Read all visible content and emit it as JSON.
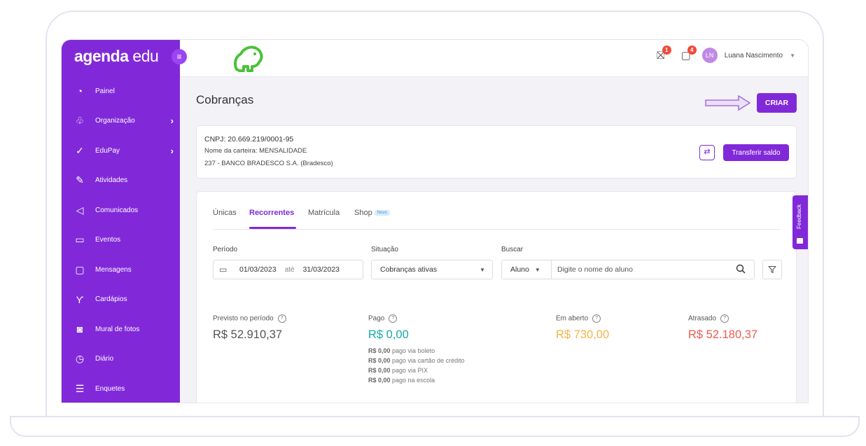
{
  "brand": {
    "name_bold": "agenda",
    "name_light": "edu"
  },
  "sidebar": {
    "items": [
      {
        "label": "Painel",
        "icon": "gauge-icon",
        "glyph": "◔"
      },
      {
        "label": "Organização",
        "icon": "org-chart-icon",
        "glyph": "♧",
        "chevron": true
      },
      {
        "label": "EduPay",
        "icon": "check-icon",
        "glyph": "✓",
        "chevron": true
      },
      {
        "label": "Atividades",
        "icon": "pencil-icon",
        "glyph": "✎"
      },
      {
        "label": "Comunicados",
        "icon": "megaphone-icon",
        "glyph": "◁"
      },
      {
        "label": "Eventos",
        "icon": "calendar-icon",
        "glyph": "▭"
      },
      {
        "label": "Mensagens",
        "icon": "chat-icon",
        "glyph": "▢"
      },
      {
        "label": "Cardápios",
        "icon": "cutlery-icon",
        "glyph": "ϒ"
      },
      {
        "label": "Mural de fotos",
        "icon": "camera-icon",
        "glyph": "◙"
      },
      {
        "label": "Diário",
        "icon": "clock-icon",
        "glyph": "◷"
      },
      {
        "label": "Enquetes",
        "icon": "list-icon",
        "glyph": "☰"
      }
    ]
  },
  "header": {
    "gift_badge": "1",
    "chat_badge": "4",
    "user_initials": "LN",
    "user_name": "Luana Nascimento"
  },
  "page": {
    "title": "Cobranças",
    "create_label": "CRIAR"
  },
  "account": {
    "cnpj": "CNPJ: 20.669.219/0001-95",
    "wallet": "Nome da carteira: MENSALIDADE",
    "bank": "237 - BANCO BRADESCO S.A. (Bradesco)",
    "transfer_label": "Transferir saldo"
  },
  "tabs": [
    {
      "label": "Únicas"
    },
    {
      "label": "Recorrentes",
      "active": true
    },
    {
      "label": "Matrícula"
    },
    {
      "label": "Shop",
      "tag": "Novo"
    }
  ],
  "filters": {
    "period_label": "Período",
    "date_from": "01/03/2023",
    "date_sep": "até",
    "date_to": "31/03/2023",
    "status_label": "Situação",
    "status_value": "Cobranças ativas",
    "search_label": "Buscar",
    "search_scope": "Aluno",
    "search_placeholder": "Digite o nome do aluno"
  },
  "stats": {
    "forecast_label": "Previsto no período",
    "forecast_value": "R$ 52.910,37",
    "paid_label": "Pago",
    "paid_value": "R$ 0,00",
    "open_label": "Em aberto",
    "open_value": "R$ 730,00",
    "late_label": "Atrasado",
    "late_value": "R$ 52.180,37",
    "breakdown": [
      {
        "amount": "R$ 0,00",
        "text": " pago via boleto"
      },
      {
        "amount": "R$ 0,00",
        "text": " pago via cartão de crédito"
      },
      {
        "amount": "R$ 0,00",
        "text": " pago via PIX"
      },
      {
        "amount": "R$ 0,00",
        "text": " pago na escola"
      }
    ]
  },
  "feedback_label": "Feedback",
  "colors": {
    "brand": "#8129d9",
    "paid": "#18a9a9",
    "open": "#f3b44a",
    "late": "#ef5b4f",
    "logo": "#49c23a"
  }
}
